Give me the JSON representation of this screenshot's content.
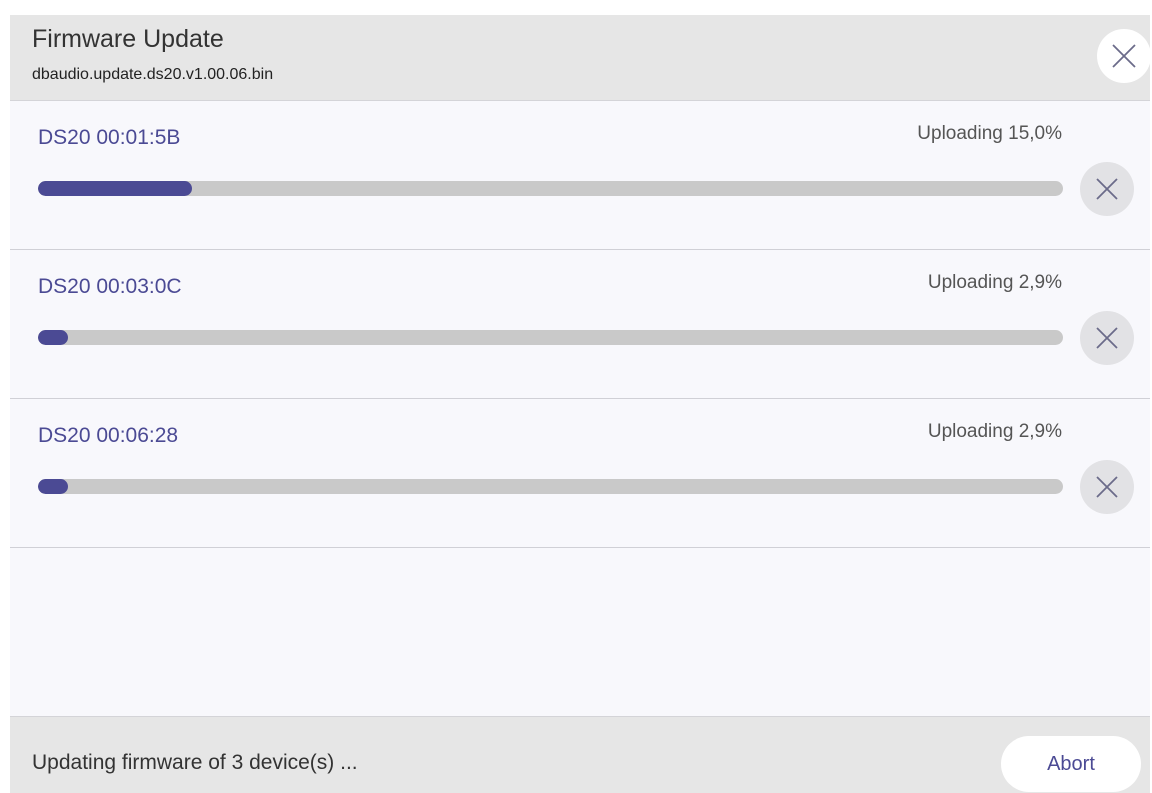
{
  "dialog": {
    "title": "Firmware Update",
    "subtitle": "dbaudio.update.ds20.v1.00.06.bin",
    "close_icon": "close-icon"
  },
  "devices": [
    {
      "name": "DS20 00:01:5B",
      "status": "Uploading 15,0%",
      "progress": 0.15,
      "cancel_icon": "close-icon"
    },
    {
      "name": "DS20 00:03:0C",
      "status": "Uploading 2,9%",
      "progress": 0.029,
      "cancel_icon": "close-icon"
    },
    {
      "name": "DS20 00:06:28",
      "status": "Uploading 2,9%",
      "progress": 0.029,
      "cancel_icon": "close-icon"
    }
  ],
  "footer": {
    "status": "Updating firmware of 3 device(s) ...",
    "abort_label": "Abort"
  },
  "colors": {
    "accent": "#4b4a94",
    "header_bg": "#e6e6e6",
    "track": "#c9c9c9"
  }
}
